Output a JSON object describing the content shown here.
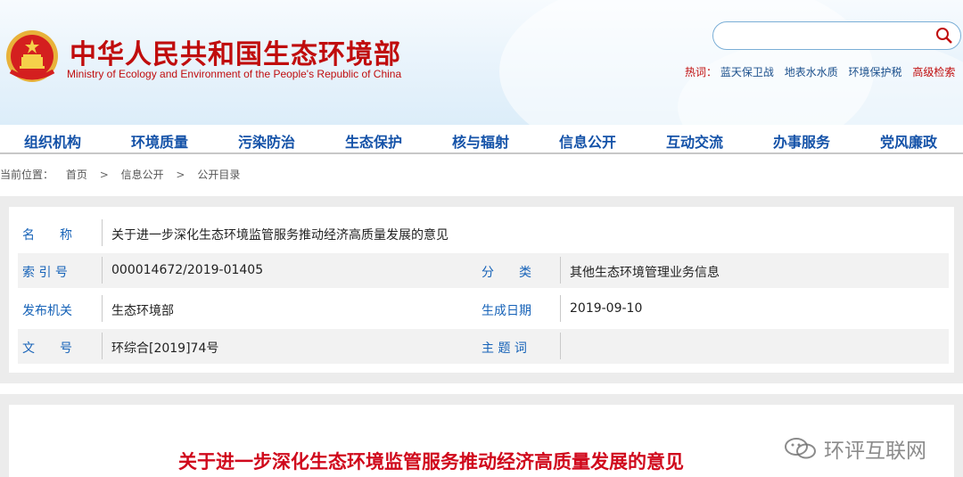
{
  "header": {
    "title_cn": "中华人民共和国生态环境部",
    "title_en": "Ministry of Ecology and Environment of the People's Republic of China",
    "search": {
      "placeholder": ""
    },
    "hotwords_label": "热词：",
    "hotwords": [
      "蓝天保卫战",
      "地表水水质",
      "环境保护税"
    ],
    "advanced_search": "高级检索"
  },
  "nav": [
    "组织机构",
    "环境质量",
    "污染防治",
    "生态保护",
    "核与辐射",
    "信息公开",
    "互动交流",
    "办事服务",
    "党风廉政"
  ],
  "breadcrumb": {
    "label": "当前位置：",
    "items": [
      "首页",
      "信息公开",
      "公开目录"
    ],
    "separator": ">"
  },
  "info": {
    "name_label": "名　　称",
    "name_value": "关于进一步深化生态环境监管服务推动经济高质量发展的意见",
    "index_label": "索 引 号",
    "index_value": "000014672/2019-01405",
    "category_label": "分　　类",
    "category_value": "其他生态环境管理业务信息",
    "issuer_label": "发布机关",
    "issuer_value": "生态环境部",
    "date_label": "生成日期",
    "date_value": "2019-09-10",
    "docno_label": "文　　号",
    "docno_value": "环综合[2019]74号",
    "subject_label": "主 题 词",
    "subject_value": ""
  },
  "document": {
    "title": "关于进一步深化生态环境监管服务推动经济高质量发展的意见"
  },
  "watermark": "环评互联网",
  "colors": {
    "brand_red": "#c00d0d",
    "nav_blue": "#1452a8",
    "label_blue": "#1763b8",
    "title_red": "#d0091c"
  }
}
